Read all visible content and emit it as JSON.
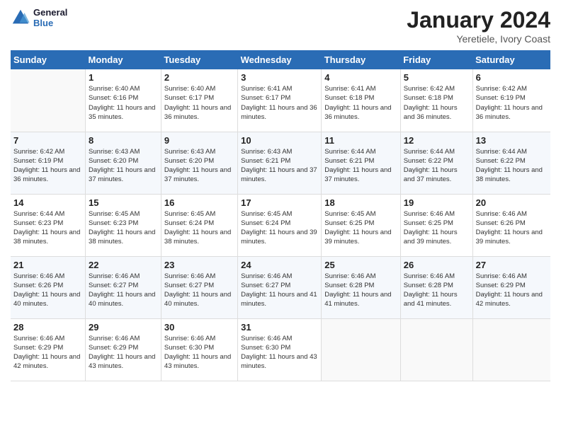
{
  "logo": {
    "text_general": "General",
    "text_blue": "Blue"
  },
  "header": {
    "title": "January 2024",
    "subtitle": "Yeretiele, Ivory Coast"
  },
  "columns": [
    "Sunday",
    "Monday",
    "Tuesday",
    "Wednesday",
    "Thursday",
    "Friday",
    "Saturday"
  ],
  "weeks": [
    [
      {
        "day": "",
        "sunrise": "",
        "sunset": "",
        "daylight": ""
      },
      {
        "day": "1",
        "sunrise": "Sunrise: 6:40 AM",
        "sunset": "Sunset: 6:16 PM",
        "daylight": "Daylight: 11 hours and 35 minutes."
      },
      {
        "day": "2",
        "sunrise": "Sunrise: 6:40 AM",
        "sunset": "Sunset: 6:17 PM",
        "daylight": "Daylight: 11 hours and 36 minutes."
      },
      {
        "day": "3",
        "sunrise": "Sunrise: 6:41 AM",
        "sunset": "Sunset: 6:17 PM",
        "daylight": "Daylight: 11 hours and 36 minutes."
      },
      {
        "day": "4",
        "sunrise": "Sunrise: 6:41 AM",
        "sunset": "Sunset: 6:18 PM",
        "daylight": "Daylight: 11 hours and 36 minutes."
      },
      {
        "day": "5",
        "sunrise": "Sunrise: 6:42 AM",
        "sunset": "Sunset: 6:18 PM",
        "daylight": "Daylight: 11 hours and 36 minutes."
      },
      {
        "day": "6",
        "sunrise": "Sunrise: 6:42 AM",
        "sunset": "Sunset: 6:19 PM",
        "daylight": "Daylight: 11 hours and 36 minutes."
      }
    ],
    [
      {
        "day": "7",
        "sunrise": "Sunrise: 6:42 AM",
        "sunset": "Sunset: 6:19 PM",
        "daylight": "Daylight: 11 hours and 36 minutes."
      },
      {
        "day": "8",
        "sunrise": "Sunrise: 6:43 AM",
        "sunset": "Sunset: 6:20 PM",
        "daylight": "Daylight: 11 hours and 37 minutes."
      },
      {
        "day": "9",
        "sunrise": "Sunrise: 6:43 AM",
        "sunset": "Sunset: 6:20 PM",
        "daylight": "Daylight: 11 hours and 37 minutes."
      },
      {
        "day": "10",
        "sunrise": "Sunrise: 6:43 AM",
        "sunset": "Sunset: 6:21 PM",
        "daylight": "Daylight: 11 hours and 37 minutes."
      },
      {
        "day": "11",
        "sunrise": "Sunrise: 6:44 AM",
        "sunset": "Sunset: 6:21 PM",
        "daylight": "Daylight: 11 hours and 37 minutes."
      },
      {
        "day": "12",
        "sunrise": "Sunrise: 6:44 AM",
        "sunset": "Sunset: 6:22 PM",
        "daylight": "Daylight: 11 hours and 37 minutes."
      },
      {
        "day": "13",
        "sunrise": "Sunrise: 6:44 AM",
        "sunset": "Sunset: 6:22 PM",
        "daylight": "Daylight: 11 hours and 38 minutes."
      }
    ],
    [
      {
        "day": "14",
        "sunrise": "Sunrise: 6:44 AM",
        "sunset": "Sunset: 6:23 PM",
        "daylight": "Daylight: 11 hours and 38 minutes."
      },
      {
        "day": "15",
        "sunrise": "Sunrise: 6:45 AM",
        "sunset": "Sunset: 6:23 PM",
        "daylight": "Daylight: 11 hours and 38 minutes."
      },
      {
        "day": "16",
        "sunrise": "Sunrise: 6:45 AM",
        "sunset": "Sunset: 6:24 PM",
        "daylight": "Daylight: 11 hours and 38 minutes."
      },
      {
        "day": "17",
        "sunrise": "Sunrise: 6:45 AM",
        "sunset": "Sunset: 6:24 PM",
        "daylight": "Daylight: 11 hours and 39 minutes."
      },
      {
        "day": "18",
        "sunrise": "Sunrise: 6:45 AM",
        "sunset": "Sunset: 6:25 PM",
        "daylight": "Daylight: 11 hours and 39 minutes."
      },
      {
        "day": "19",
        "sunrise": "Sunrise: 6:46 AM",
        "sunset": "Sunset: 6:25 PM",
        "daylight": "Daylight: 11 hours and 39 minutes."
      },
      {
        "day": "20",
        "sunrise": "Sunrise: 6:46 AM",
        "sunset": "Sunset: 6:26 PM",
        "daylight": "Daylight: 11 hours and 39 minutes."
      }
    ],
    [
      {
        "day": "21",
        "sunrise": "Sunrise: 6:46 AM",
        "sunset": "Sunset: 6:26 PM",
        "daylight": "Daylight: 11 hours and 40 minutes."
      },
      {
        "day": "22",
        "sunrise": "Sunrise: 6:46 AM",
        "sunset": "Sunset: 6:27 PM",
        "daylight": "Daylight: 11 hours and 40 minutes."
      },
      {
        "day": "23",
        "sunrise": "Sunrise: 6:46 AM",
        "sunset": "Sunset: 6:27 PM",
        "daylight": "Daylight: 11 hours and 40 minutes."
      },
      {
        "day": "24",
        "sunrise": "Sunrise: 6:46 AM",
        "sunset": "Sunset: 6:27 PM",
        "daylight": "Daylight: 11 hours and 41 minutes."
      },
      {
        "day": "25",
        "sunrise": "Sunrise: 6:46 AM",
        "sunset": "Sunset: 6:28 PM",
        "daylight": "Daylight: 11 hours and 41 minutes."
      },
      {
        "day": "26",
        "sunrise": "Sunrise: 6:46 AM",
        "sunset": "Sunset: 6:28 PM",
        "daylight": "Daylight: 11 hours and 41 minutes."
      },
      {
        "day": "27",
        "sunrise": "Sunrise: 6:46 AM",
        "sunset": "Sunset: 6:29 PM",
        "daylight": "Daylight: 11 hours and 42 minutes."
      }
    ],
    [
      {
        "day": "28",
        "sunrise": "Sunrise: 6:46 AM",
        "sunset": "Sunset: 6:29 PM",
        "daylight": "Daylight: 11 hours and 42 minutes."
      },
      {
        "day": "29",
        "sunrise": "Sunrise: 6:46 AM",
        "sunset": "Sunset: 6:29 PM",
        "daylight": "Daylight: 11 hours and 43 minutes."
      },
      {
        "day": "30",
        "sunrise": "Sunrise: 6:46 AM",
        "sunset": "Sunset: 6:30 PM",
        "daylight": "Daylight: 11 hours and 43 minutes."
      },
      {
        "day": "31",
        "sunrise": "Sunrise: 6:46 AM",
        "sunset": "Sunset: 6:30 PM",
        "daylight": "Daylight: 11 hours and 43 minutes."
      },
      {
        "day": "",
        "sunrise": "",
        "sunset": "",
        "daylight": ""
      },
      {
        "day": "",
        "sunrise": "",
        "sunset": "",
        "daylight": ""
      },
      {
        "day": "",
        "sunrise": "",
        "sunset": "",
        "daylight": ""
      }
    ]
  ]
}
